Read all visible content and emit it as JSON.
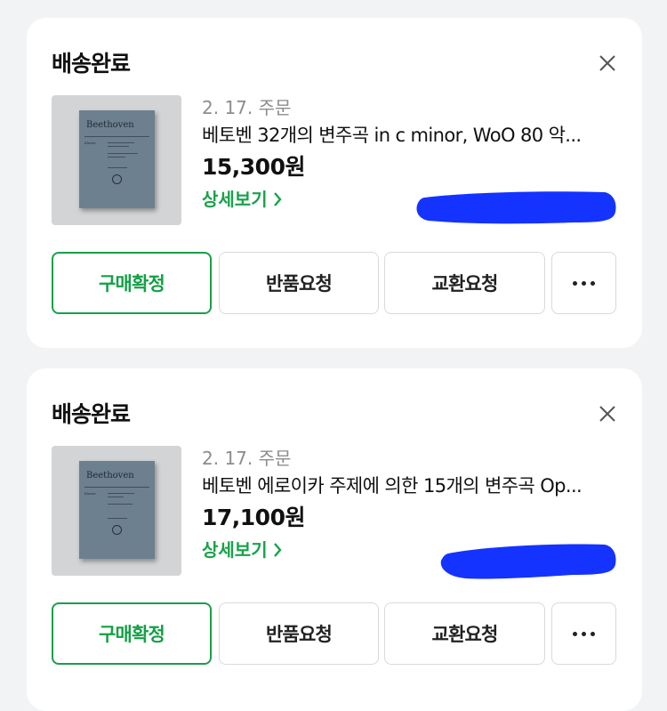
{
  "orders": [
    {
      "status": "배송완료",
      "date": "2. 17. 주문",
      "product_name": "베토벤 32개의 변주곡 in c minor, WoO 80 악...",
      "price": "15,300원",
      "detail_link": "상세보기",
      "book_title": "Beethoven",
      "buttons": {
        "confirm": "구매확정",
        "return": "반품요청",
        "exchange": "교환요청"
      }
    },
    {
      "status": "배송완료",
      "date": "2. 17. 주문",
      "product_name": "베토벤 에로이카 주제에 의한 15개의 변주곡 Op...",
      "price": "17,100원",
      "detail_link": "상세보기",
      "book_title": "Beethoven",
      "buttons": {
        "confirm": "구매확정",
        "return": "반품요청",
        "exchange": "교환요청"
      }
    }
  ],
  "colors": {
    "accent_green": "#18a34a",
    "redaction_blue": "#1433ff",
    "background": "#f2f3f5"
  },
  "icons": {
    "close": "close-icon",
    "more": "more-icon",
    "chevron": "chevron-right-icon"
  }
}
